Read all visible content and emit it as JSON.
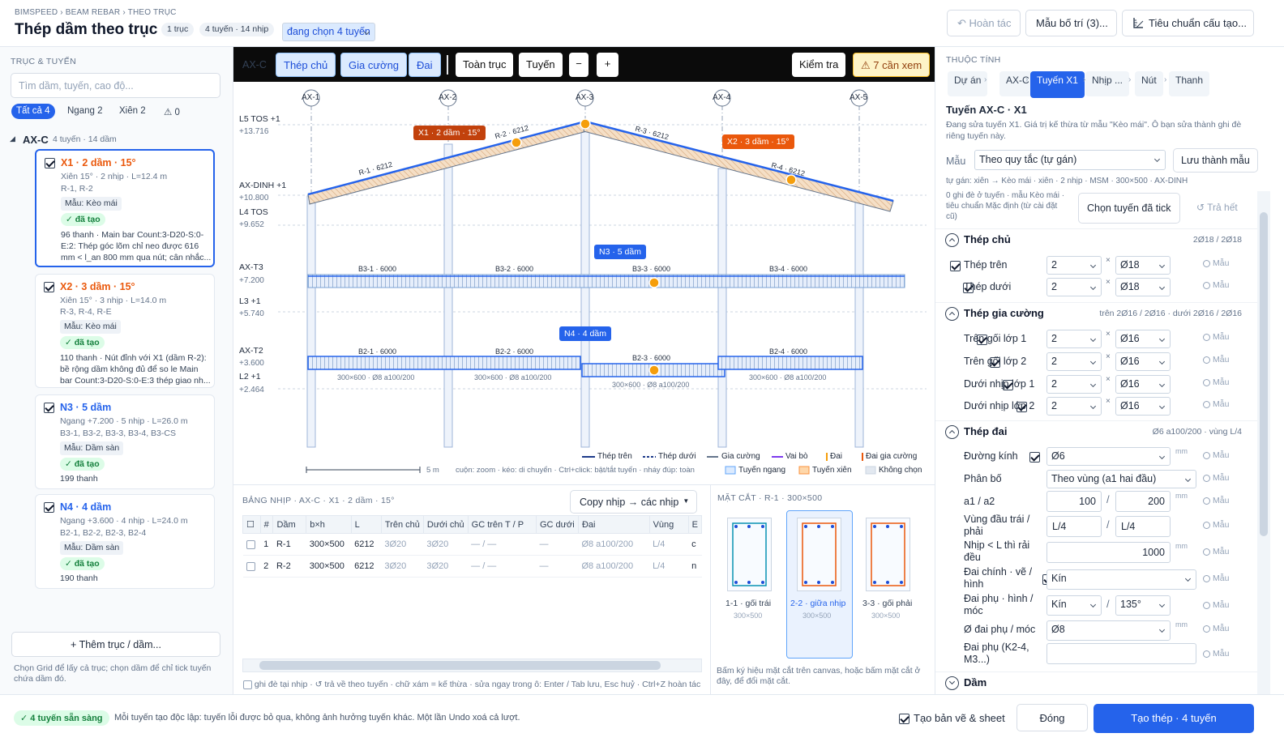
{
  "header": {
    "breadcrumb": "BIMSPEED › BEAM REBAR › THEO TRỤC",
    "title": "Thép dầm theo trục",
    "chips": [
      "1 trục",
      "4 tuyến · 14 nhịp",
      "đang chọn 4 tuyến"
    ],
    "undo": "↶ Hoàn tác",
    "template": "Mẫu bố trí (3)...",
    "standard": "Tiêu chuẩn cấu tạo..."
  },
  "left": {
    "section": "TRỤC & TUYẾN",
    "search_placeholder": "Tìm dầm, tuyến, cao độ...",
    "filters": [
      "Tất cả 4",
      "Ngang 2",
      "Xiên 2",
      "⚠ 0"
    ],
    "group_name": "AX-C",
    "group_info": "4 tuyến · 14 dầm",
    "cards": [
      {
        "title": "X1 · 2 dầm · 15°",
        "l1": "Xiên 15° · 2 nhịp · L=12.4 m",
        "l2": "R-1, R-2",
        "tag": "Mẫu: Kèo mái",
        "ok": "✓ đã tạo",
        "note": "96 thanh · Main bar Count:3-D20-S:0-E:2: Thép góc lõm chỉ neo được 616 mm < l_an 800 mm qua nút; cân nhắc..."
      },
      {
        "title": "X2 · 3 dầm · 15°",
        "l1": "Xiên 15° · 3 nhịp · L=14.0 m",
        "l2": "R-3, R-4, R-E",
        "tag": "Mẫu: Kèo mái",
        "ok": "✓ đã tạo",
        "note": "110 thanh · Nút đỉnh với X1 (dầm R-2): bề rộng dầm không đủ để so le Main bar Count:3-D20-S:0-E:3 thép giao nh..."
      },
      {
        "title": "N3 · 5 dầm",
        "l1": "Ngang +7.200 · 5 nhịp · L=26.0 m",
        "l2": "B3-1, B3-2, B3-3, B3-4, B3-CS",
        "tag": "Mẫu: Dầm sàn",
        "ok": "✓ đã tạo",
        "note": "199 thanh"
      },
      {
        "title": "N4 · 4 dầm",
        "l1": "Ngang +3.600 · 4 nhịp · L=24.0 m",
        "l2": "B2-1, B2-2, B2-3, B2-4",
        "tag": "Mẫu: Dầm sàn",
        "ok": "✓ đã tạo",
        "note": "190 thanh"
      }
    ],
    "add_button": "+ Thêm trục / dầm...",
    "hint": "Chọn Grid để lấy cả trục; chọn dầm để chỉ tick tuyến chứa dầm đó."
  },
  "toolbar": {
    "axis": "AX-C",
    "buttons": [
      "Thép chủ",
      "Gia cường",
      "Đai",
      "Toàn trục",
      "Tuyến",
      "−",
      "+"
    ],
    "check": "Kiểm tra",
    "warn": "⚠ 7 cần xem"
  },
  "canvas": {
    "grids": [
      "AX-1",
      "AX-2",
      "AX-3",
      "AX-4",
      "AX-5"
    ],
    "levels": [
      {
        "name": "L5 TOS  +1",
        "elev": "+13.716"
      },
      {
        "name": "AX-DINH  +1",
        "elev": "+10.800"
      },
      {
        "name": "L4 TOS",
        "elev": "+9.652"
      },
      {
        "name": "AX-T3",
        "elev": "+7.200"
      },
      {
        "name": "L3  +1",
        "elev": "+5.740"
      },
      {
        "name": "AX-T2",
        "elev": "+3.600"
      },
      {
        "name": "L2  +1",
        "elev": "+2.464"
      }
    ],
    "roof_labels": [
      "R-1 · 6212",
      "R-2 · 6212",
      "R-3 · 6212",
      "R-4 · 6212"
    ],
    "b3_labels": [
      "B3-1 · 6000",
      "B3-2 · 6000",
      "B3-3 · 6000",
      "B3-4 · 6000"
    ],
    "b2_labels": [
      "B2-1 · 6000",
      "B2-2 · 6000",
      "B2-3 · 6000",
      "B2-4 · 6000"
    ],
    "section_text": "300×600 · Ø8 a100/200",
    "b2_3_section": "300×600 · Ø8 a100/200",
    "callouts": {
      "x1": "X1 · 2 dầm · 15°",
      "x2": "X2 · 3 dầm · 15°",
      "n3": "N3 · 5 dầm",
      "n4": "N4 · 4 dầm"
    },
    "legend": [
      "Thép trên",
      "Thép dưới",
      "Gia cường",
      "Vai bò",
      "Đai",
      "Đai gia cường"
    ],
    "legend2": [
      "Tuyến ngang",
      "Tuyến xiên",
      "Không chọn"
    ],
    "scale": "5 m",
    "hint": "cuộn: zoom · kéo: di chuyển · Ctrl+click: bật/tắt tuyến · nháy đúp: toàn"
  },
  "span_table": {
    "title": "BẢNG NHỊP · AX-C · X1 · 2 dầm · 15°",
    "copy": "Copy nhịp → các nhịp",
    "columns": [
      "☐",
      "#",
      "Dầm",
      "b×h",
      "L",
      "Trên chủ",
      "Dưới chủ",
      "GC trên T / P",
      "GC dưới",
      "Đai",
      "Vùng",
      "E"
    ],
    "rows": [
      [
        "",
        "1",
        "R-1",
        "300×500",
        "6212",
        "3Ø20",
        "3Ø20",
        "— / —",
        "—",
        "Ø8 a100/200",
        "L/4",
        "c"
      ],
      [
        "",
        "2",
        "R-2",
        "300×500",
        "6212",
        "3Ø20",
        "3Ø20",
        "— / —",
        "—",
        "Ø8 a100/200",
        "L/4",
        "n"
      ]
    ],
    "foot": "ghi đè tại nhịp · ↺ trả về theo tuyến · chữ xám = kế thừa · sửa ngay trong ô: Enter / Tab lưu, Esc huỷ · Ctrl+Z hoàn tác"
  },
  "section": {
    "title": "MẶT CẮT · R-1 · 300×500",
    "items": [
      {
        "name": "1-1 · gối trái",
        "size": "300×500"
      },
      {
        "name": "2-2 · giữa nhịp",
        "size": "300×500"
      },
      {
        "name": "3-3 · gối phải",
        "size": "300×500"
      }
    ],
    "hint": "Bấm ký hiệu mặt cắt trên canvas, hoặc bấm mặt cắt ở đây, để đổi mặt cắt."
  },
  "props": {
    "section": "THUỘC TÍNH",
    "tabs": [
      "Dự án",
      "AX-C",
      "Tuyến X1",
      "Nhịp ...",
      "Nút",
      "Thanh"
    ],
    "heading": "Tuyến AX-C · X1",
    "desc": "Đang sửa tuyến X1. Giá trị kế thừa từ mẫu \"Kèo mái\". Ô bạn sửa thành ghi đè riêng tuyến này.",
    "mau_label": "Mẫu",
    "mau_value": "Theo quy tắc (tự gán)",
    "save_template": "Lưu thành mẫu",
    "autoline": "tự gán: xiên → Kèo mái · xiên · 2 nhịp · MSM · 300×500 · AX-DINH",
    "overrides": "0 ghi đè ở tuyến · mẫu Kèo mái · tiêu chuẩn Mặc định (từ cài đặt cũ)",
    "choose": "Chọn tuyến đã tick",
    "reset": "↺ Trả hết",
    "main": {
      "title": "Thép chủ",
      "sum": "2Ø18 / 2Ø18",
      "rows": [
        {
          "label": "Thép trên",
          "n": "2",
          "d": "Ø18"
        },
        {
          "label": "Thép dưới",
          "n": "2",
          "d": "Ø18"
        }
      ]
    },
    "add": {
      "title": "Thép gia cường",
      "sum": "trên 2Ø16 / 2Ø16 · dưới 2Ø16 / 2Ø16",
      "rows": [
        {
          "label": "Trên gối lớp 1",
          "n": "2",
          "d": "Ø16"
        },
        {
          "label": "Trên gối lớp 2",
          "n": "2",
          "d": "Ø16"
        },
        {
          "label": "Dưới nhịp lớp 1",
          "n": "2",
          "d": "Ø16"
        },
        {
          "label": "Dưới nhịp lớp 2",
          "n": "2",
          "d": "Ø16"
        }
      ]
    },
    "stir": {
      "title": "Thép đai",
      "sum": "Ø6 a100/200 · vùng L/4",
      "dia_label": "Đường kính",
      "dia": "Ø6",
      "dist_label": "Phân bố",
      "dist": "Theo vùng (a1 hai đầu)",
      "a_label": "a1 / a2",
      "a1": "100",
      "a2": "200",
      "zone_label": "Vùng đầu trái / phải",
      "zl": "L/4",
      "zr": "L/4",
      "even_label": "Nhịp < L thì rải đều",
      "even": "1000",
      "main_label": "Đai chính · vẽ / hình",
      "main": "Kín",
      "sub_label": "Đai phụ · hình / móc",
      "sub": "Kín",
      "hook": "135°",
      "subd_label": "Ø đai phụ / móc",
      "subd": "Ø8",
      "k2_label": "Đai phụ (K2-4, M3...)",
      "mm": "mm"
    },
    "beam": "Dầm",
    "mau": "Mẫu"
  },
  "footer": {
    "ready": "✓ 4 tuyến sẵn sàng",
    "info": "Mỗi tuyến tạo độc lập: tuyến lỗi được bỏ qua, không ảnh hưởng tuyến khác. Một lần Undo xoá cả lượt.",
    "draw": "Tạo bản vẽ & sheet",
    "close": "Đóng",
    "create": "Tạo thép · 4 tuyến"
  },
  "colors": {
    "accent": "#2563eb",
    "roof": "#e8c9a8",
    "floor": "#dbeafe",
    "warn": "#f59e0b",
    "callout": "#c2410c"
  }
}
